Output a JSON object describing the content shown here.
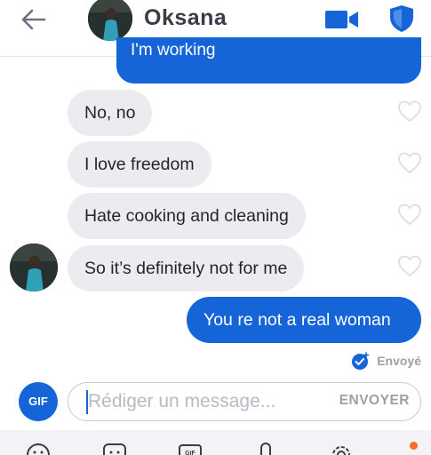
{
  "header": {
    "title": "Oksana",
    "back_icon": "arrow-left-icon",
    "video_icon": "video-call-icon",
    "shield_icon": "shield-icon"
  },
  "messages": [
    {
      "direction": "out",
      "text": "I'm working"
    },
    {
      "direction": "in",
      "text": "No, no"
    },
    {
      "direction": "in",
      "text": "I love freedom"
    },
    {
      "direction": "in",
      "text": "Hate cooking and cleaning"
    },
    {
      "direction": "in",
      "text": "So it’s definitely not for me"
    },
    {
      "direction": "out",
      "text": "You re not a real woman"
    }
  ],
  "status": {
    "label": "Envoyé",
    "icon": "delivered-check-icon"
  },
  "composer": {
    "gif_label": "GIF",
    "placeholder": "Rédiger un message...",
    "send_label": "ENVOYER"
  },
  "toolbar": {
    "icons": [
      "emoji-icon",
      "sticker-icon",
      "gif-icon",
      "microphone-icon",
      "settings-icon",
      "more-icon"
    ]
  },
  "colors": {
    "accent": "#1565d8",
    "incoming_bubble": "#ececf0",
    "notification_dot": "#ff6a2b"
  }
}
